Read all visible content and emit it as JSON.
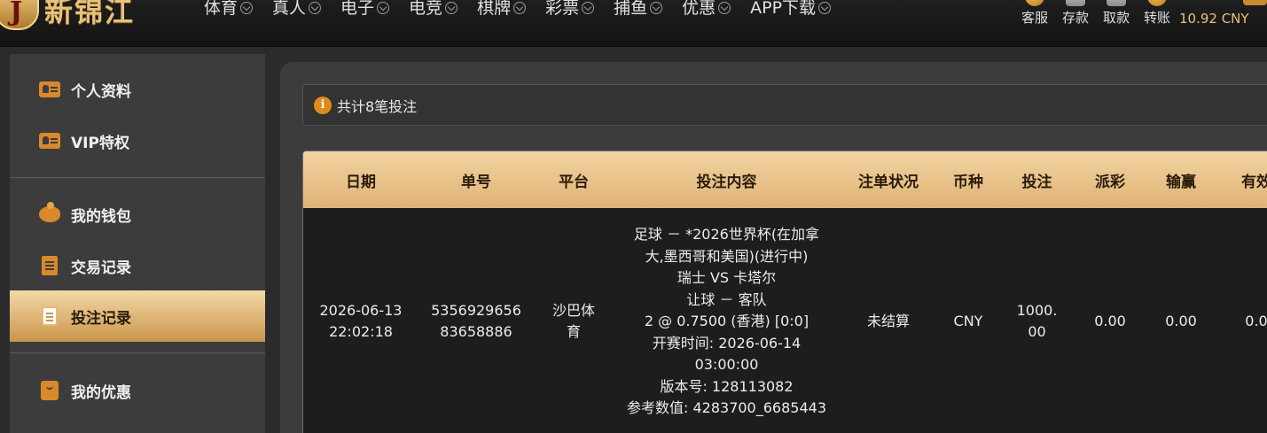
{
  "header": {
    "logo_text": "新锦江",
    "nav": [
      "体育",
      "真人",
      "电子",
      "电竞",
      "棋牌",
      "彩票",
      "捕鱼",
      "优惠",
      "APP下载"
    ],
    "actions": [
      "客服",
      "存款",
      "取款",
      "转账"
    ],
    "balance": "10.92 CNY",
    "accent": "#e8c17a"
  },
  "sidebar": {
    "items": [
      {
        "label": "个人资料",
        "icon": "profile-card-icon"
      },
      {
        "label": "VIP特权",
        "icon": "vip-card-icon"
      },
      {
        "label": "我的钱包",
        "icon": "piggy-bank-icon"
      },
      {
        "label": "交易记录",
        "icon": "list-icon"
      },
      {
        "label": "投注记录",
        "icon": "document-icon",
        "active": true
      },
      {
        "label": "我的优惠",
        "icon": "gift-bag-icon"
      }
    ]
  },
  "main": {
    "info": "共计8笔投注",
    "table": {
      "headers": [
        "日期",
        "单号",
        "平台",
        "投注内容",
        "注单状况",
        "币种",
        "投注",
        "派彩",
        "输赢",
        "有效"
      ],
      "row": {
        "date_line1": "2026-06-13",
        "date_line2": "22:02:18",
        "id_line1": "5356929656",
        "id_line2": "83658886",
        "platform_line1": "沙巴体",
        "platform_line2": "育",
        "detail": [
          "足球 － *2026世界杯(在加拿",
          "大,墨西哥和美国)(进行中)",
          "瑞士 VS 卡塔尔",
          "让球 － 客队",
          "2 @ 0.7500 (香港) [0:0]",
          "开赛时间: 2026-06-14",
          "03:00:00",
          "版本号: 128113082",
          "参考数值:  4283700_6685443"
        ],
        "status": "未结算",
        "currency": "CNY",
        "stake_line1": "1000.",
        "stake_line2": "00",
        "payout": "0.00",
        "winloss": "0.00",
        "valid": "0.0"
      }
    }
  }
}
